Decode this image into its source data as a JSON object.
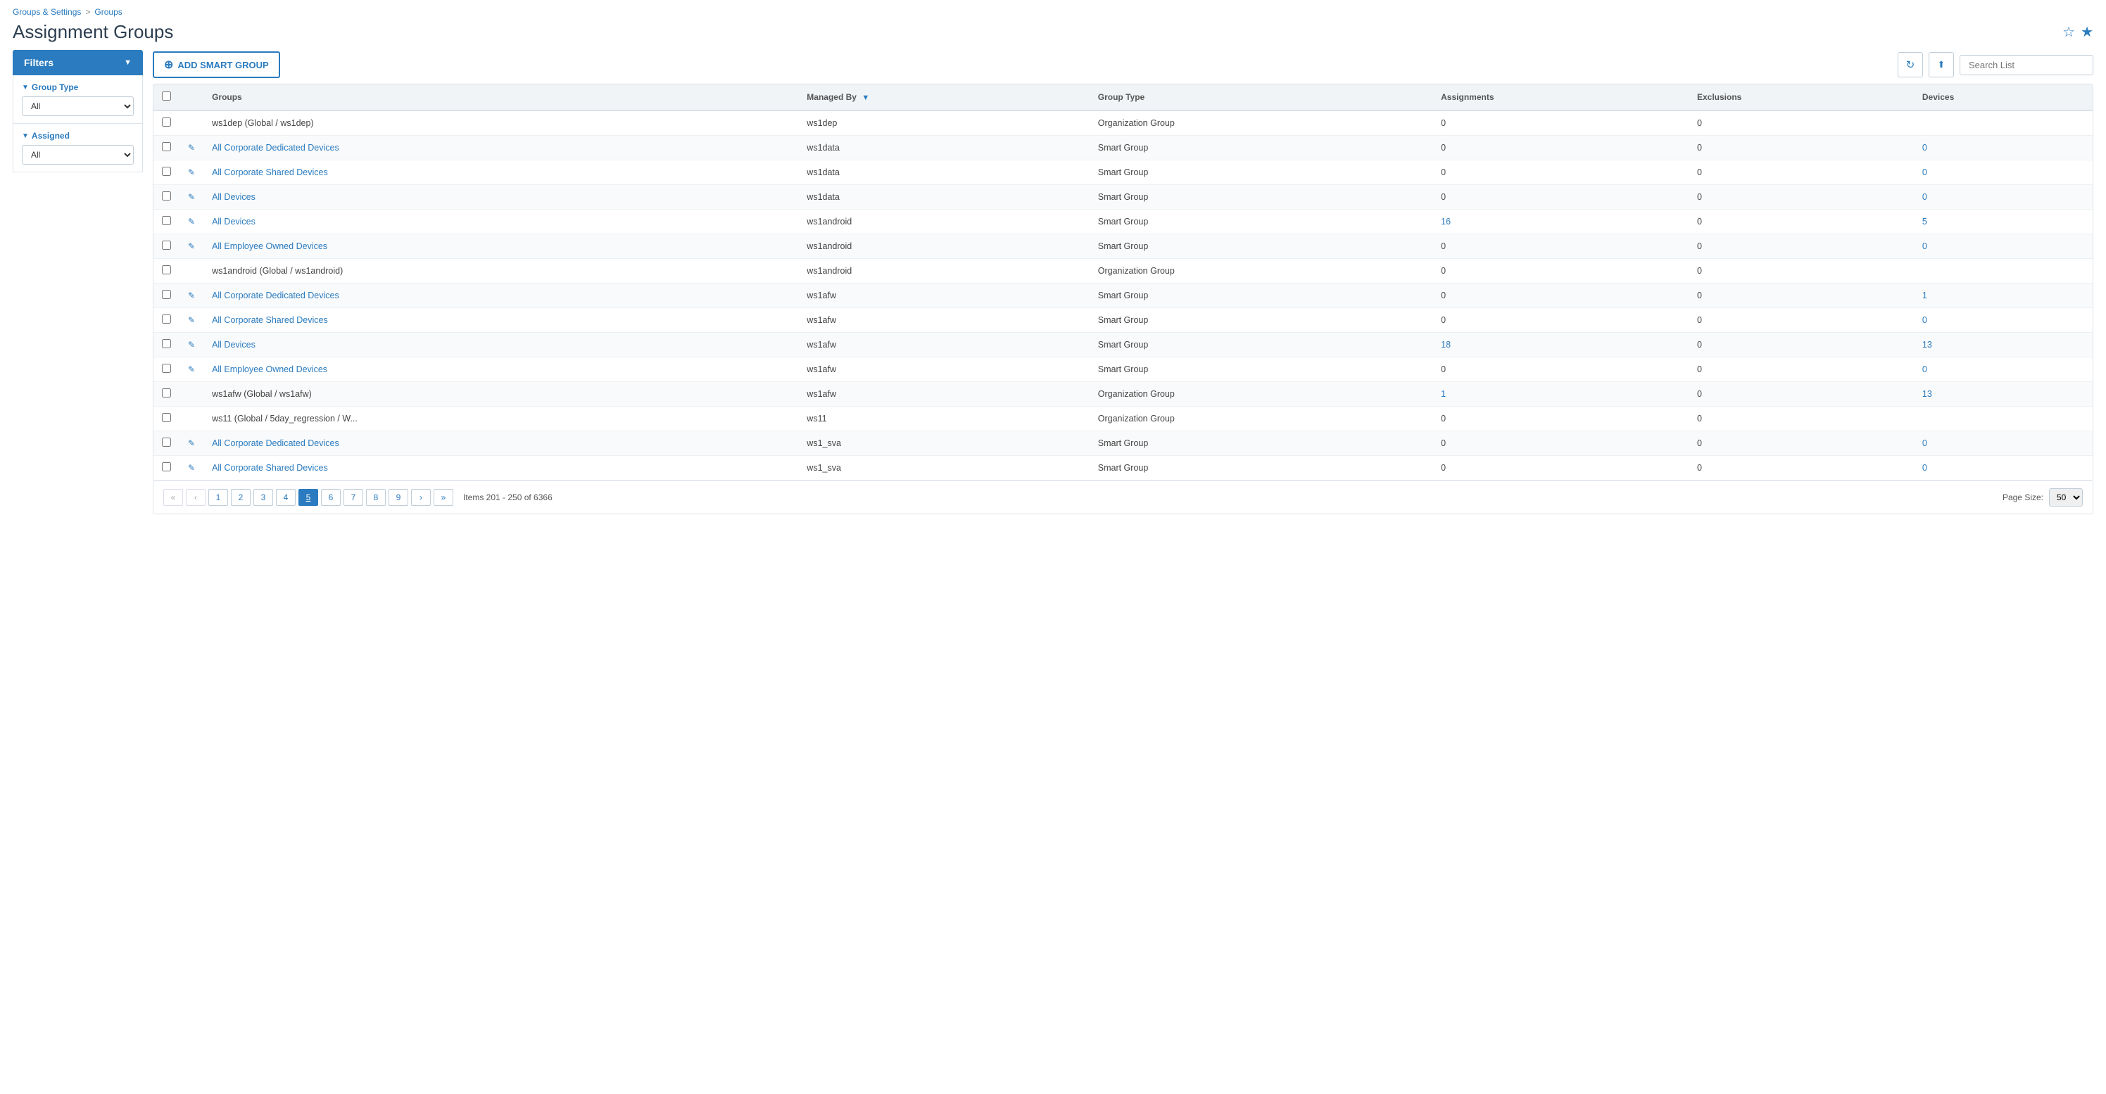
{
  "breadcrumb": {
    "part1": "Groups & Settings",
    "separator": ">",
    "part2": "Groups"
  },
  "page": {
    "title": "Assignment Groups"
  },
  "filters": {
    "button_label": "Filters",
    "group_type_label": "Group Type",
    "group_type_default": "All",
    "assigned_label": "Assigned",
    "assigned_default": "All"
  },
  "toolbar": {
    "add_smart_group_label": "ADD SMART GROUP",
    "search_placeholder": "Search List",
    "refresh_icon": "↻",
    "export_icon": "⬆"
  },
  "table": {
    "columns": [
      "",
      "",
      "Groups",
      "Managed By",
      "Group Type",
      "Assignments",
      "Exclusions",
      "Devices"
    ],
    "rows": [
      {
        "checkbox": true,
        "edit": false,
        "group": "ws1dep (Global / ws1dep)",
        "managed_by": "ws1dep",
        "group_type": "Organization Group",
        "assignments": "0",
        "exclusions": "0",
        "devices": "",
        "group_link": false,
        "devices_link": false
      },
      {
        "checkbox": true,
        "edit": true,
        "group": "All Corporate Dedicated Devices",
        "managed_by": "ws1data",
        "group_type": "Smart Group",
        "assignments": "0",
        "exclusions": "0",
        "devices": "0",
        "group_link": true,
        "devices_link": true
      },
      {
        "checkbox": true,
        "edit": true,
        "group": "All Corporate Shared Devices",
        "managed_by": "ws1data",
        "group_type": "Smart Group",
        "assignments": "0",
        "exclusions": "0",
        "devices": "0",
        "group_link": true,
        "devices_link": true
      },
      {
        "checkbox": true,
        "edit": true,
        "group": "All Devices",
        "managed_by": "ws1data",
        "group_type": "Smart Group",
        "assignments": "0",
        "exclusions": "0",
        "devices": "0",
        "group_link": true,
        "devices_link": true
      },
      {
        "checkbox": true,
        "edit": true,
        "group": "All Devices",
        "managed_by": "ws1android",
        "group_type": "Smart Group",
        "assignments": "16",
        "exclusions": "0",
        "devices": "5",
        "group_link": true,
        "devices_link": true,
        "assignments_link": true
      },
      {
        "checkbox": true,
        "edit": true,
        "group": "All Employee Owned Devices",
        "managed_by": "ws1android",
        "group_type": "Smart Group",
        "assignments": "0",
        "exclusions": "0",
        "devices": "0",
        "group_link": true,
        "devices_link": true
      },
      {
        "checkbox": true,
        "edit": false,
        "group": "ws1android (Global / ws1android)",
        "managed_by": "ws1android",
        "group_type": "Organization Group",
        "assignments": "0",
        "exclusions": "0",
        "devices": "",
        "group_link": false,
        "devices_link": false
      },
      {
        "checkbox": true,
        "edit": true,
        "group": "All Corporate Dedicated Devices",
        "managed_by": "ws1afw",
        "group_type": "Smart Group",
        "assignments": "0",
        "exclusions": "0",
        "devices": "1",
        "group_link": true,
        "devices_link": true
      },
      {
        "checkbox": true,
        "edit": true,
        "group": "All Corporate Shared Devices",
        "managed_by": "ws1afw",
        "group_type": "Smart Group",
        "assignments": "0",
        "exclusions": "0",
        "devices": "0",
        "group_link": true,
        "devices_link": true
      },
      {
        "checkbox": true,
        "edit": true,
        "group": "All Devices",
        "managed_by": "ws1afw",
        "group_type": "Smart Group",
        "assignments": "18",
        "exclusions": "0",
        "devices": "13",
        "group_link": true,
        "devices_link": true,
        "assignments_link": true
      },
      {
        "checkbox": true,
        "edit": true,
        "group": "All Employee Owned Devices",
        "managed_by": "ws1afw",
        "group_type": "Smart Group",
        "assignments": "0",
        "exclusions": "0",
        "devices": "0",
        "group_link": true,
        "devices_link": true
      },
      {
        "checkbox": true,
        "edit": false,
        "group": "ws1afw (Global / ws1afw)",
        "managed_by": "ws1afw",
        "group_type": "Organization Group",
        "assignments": "1",
        "exclusions": "0",
        "devices": "13",
        "group_link": false,
        "devices_link": false,
        "assignments_link": true,
        "devices_num_link": true
      },
      {
        "checkbox": true,
        "edit": false,
        "group": "ws11 (Global / 5day_regression / W...",
        "managed_by": "ws11",
        "group_type": "Organization Group",
        "assignments": "0",
        "exclusions": "0",
        "devices": "",
        "group_link": false,
        "devices_link": false
      },
      {
        "checkbox": true,
        "edit": true,
        "group": "All Corporate Dedicated Devices",
        "managed_by": "ws1_sva",
        "group_type": "Smart Group",
        "assignments": "0",
        "exclusions": "0",
        "devices": "0",
        "group_link": true,
        "devices_link": true
      },
      {
        "checkbox": true,
        "edit": true,
        "group": "All Corporate Shared Devices",
        "managed_by": "ws1_sva",
        "group_type": "Smart Group",
        "assignments": "0",
        "exclusions": "0",
        "devices": "0",
        "group_link": true,
        "devices_link": true
      }
    ]
  },
  "pagination": {
    "first_label": "«",
    "prev_label": "‹",
    "pages": [
      "1",
      "2",
      "3",
      "4",
      "5",
      "6",
      "7",
      "8",
      "9"
    ],
    "active_page": "5",
    "next_label": "›",
    "last_label": "»",
    "items_info": "Items 201 - 250 of 6366",
    "page_size_label": "Page Size:",
    "page_size_value": "50"
  },
  "colors": {
    "primary_blue": "#2a7bbf",
    "header_bg": "#2a7bbf",
    "link_blue": "#2a7bbf"
  }
}
